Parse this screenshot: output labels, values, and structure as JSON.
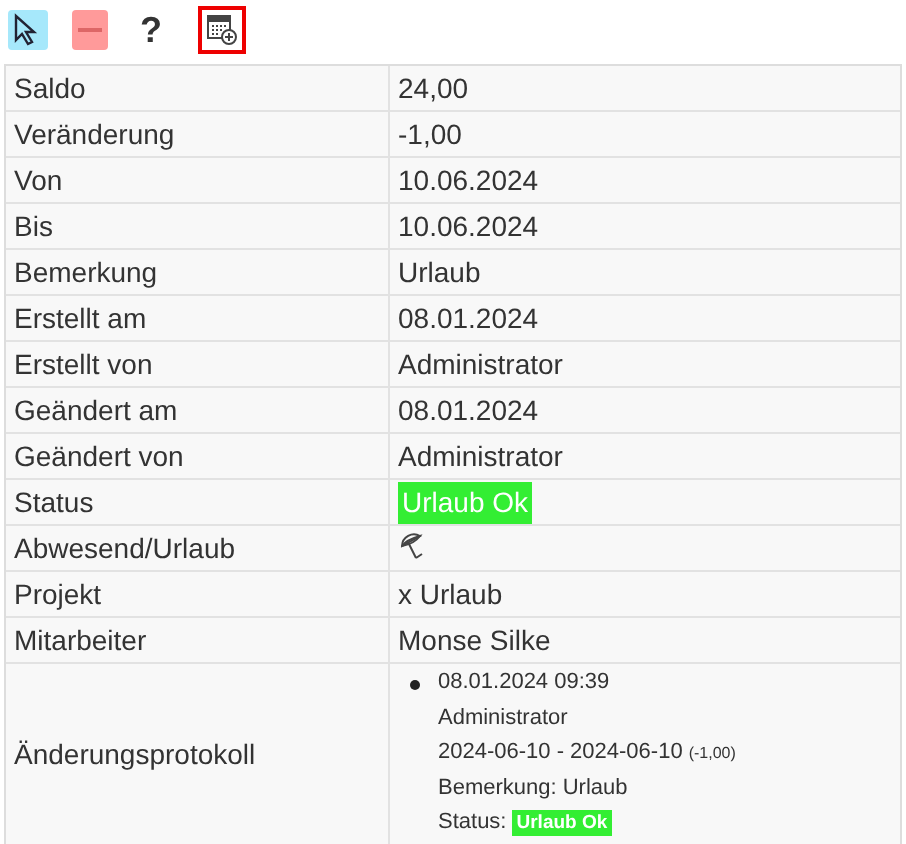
{
  "toolbar": [
    {
      "kind": "pointer",
      "selected": false
    },
    {
      "kind": "remove",
      "selected": false
    },
    {
      "kind": "help",
      "label": "?",
      "selected": false
    },
    {
      "kind": "calendar-add",
      "selected": true
    }
  ],
  "rows": [
    {
      "label": "Saldo",
      "kind": "text",
      "value": "24,00"
    },
    {
      "label": "Veränderung",
      "kind": "text",
      "value": "-1,00"
    },
    {
      "label": "Von",
      "kind": "text",
      "value": "10.06.2024"
    },
    {
      "label": "Bis",
      "kind": "text",
      "value": "10.06.2024"
    },
    {
      "label": "Bemerkung",
      "kind": "text",
      "value": "Urlaub"
    },
    {
      "label": "Erstellt am",
      "kind": "text",
      "value": "08.01.2024"
    },
    {
      "label": "Erstellt von",
      "kind": "text",
      "value": "Administrator"
    },
    {
      "label": "Geändert am",
      "kind": "text",
      "value": "08.01.2024"
    },
    {
      "label": "Geändert von",
      "kind": "text",
      "value": "Administrator"
    },
    {
      "label": "Status",
      "kind": "status",
      "value": "Urlaub Ok",
      "color": "#33ee33"
    },
    {
      "label": "Abwesend/Urlaub",
      "kind": "icon"
    },
    {
      "label": "Projekt",
      "kind": "text",
      "value": "x Urlaub"
    },
    {
      "label": "Mitarbeiter",
      "kind": "text",
      "value": "Monse Silke"
    },
    {
      "label": "Änderungsprotokoll",
      "kind": "log",
      "entries": [
        {
          "timestamp": "08.01.2024 09:39",
          "user": "Administrator",
          "range": "2024-06-10 - 2024-06-10",
          "change": "(-1,00)",
          "remark": "Bemerkung: Urlaub",
          "status_label": "Status:",
          "status": "Urlaub Ok",
          "color": "#33ee33"
        }
      ]
    }
  ]
}
